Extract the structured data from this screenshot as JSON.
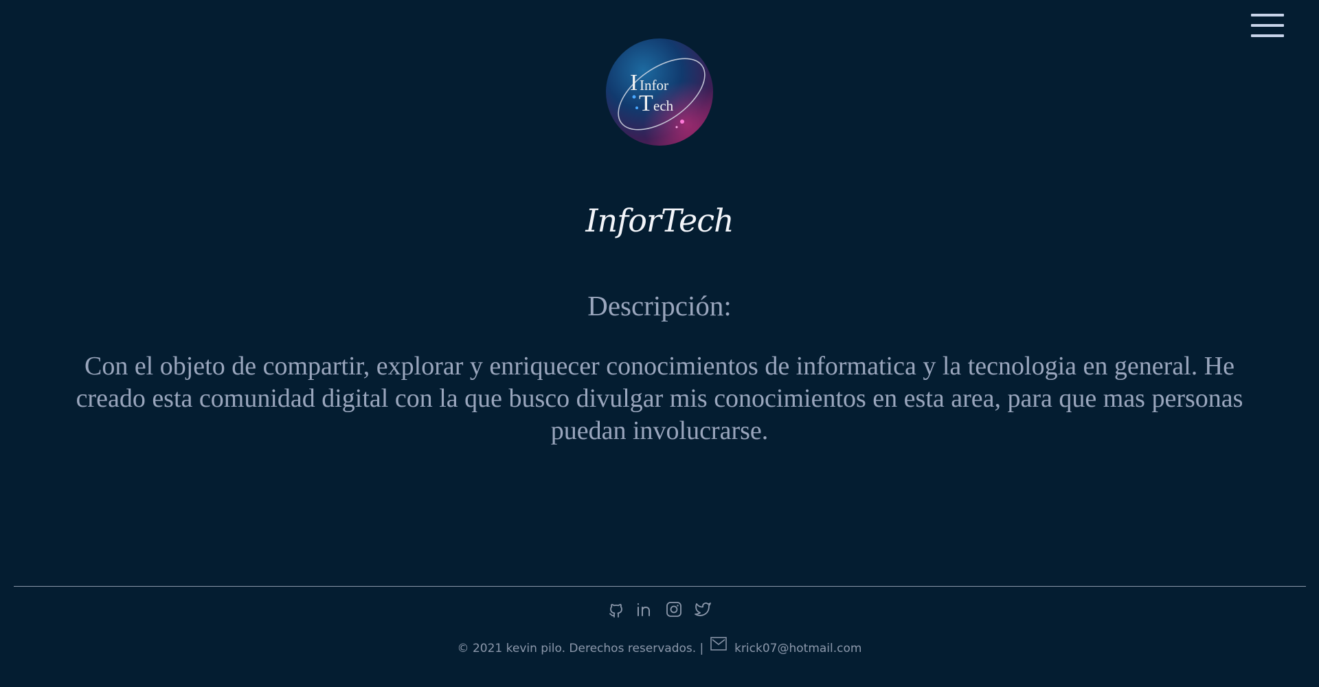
{
  "header": {
    "menu_icon": "hamburger-icon"
  },
  "logo": {
    "line1": "Infor",
    "line2": "Tech"
  },
  "main": {
    "title": "InforTech",
    "description_heading": "Descripción:",
    "description_text": "Con el objeto de compartir, explorar y enriquecer conocimientos de informatica y la tecnologia en general. He creado esta comunidad digital con la que busco divulgar mis conocimientos en esta area, para que mas personas puedan involucrarse."
  },
  "footer": {
    "social_icons": [
      "github-icon",
      "linkedin-icon",
      "instagram-icon",
      "twitter-icon"
    ],
    "copyright": "© 2021 kevin pilo. Derechos reservados. |",
    "email_icon": "mail-icon",
    "email": "krick07@hotmail.com"
  },
  "colors": {
    "background": "#041d31",
    "text": "#9aa6bd",
    "title": "#f3f5fa"
  }
}
